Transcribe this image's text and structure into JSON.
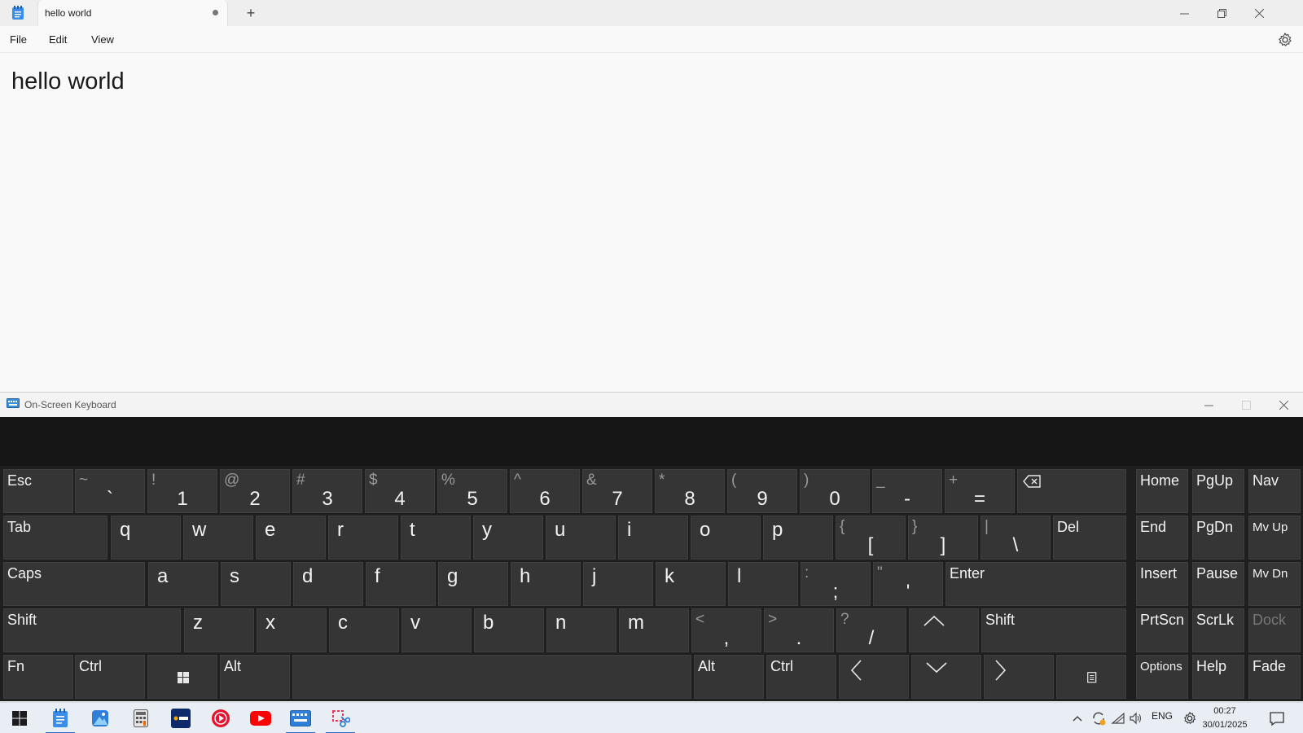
{
  "notepad": {
    "tab_title": "hello world",
    "new_tab_label": "+",
    "menu": {
      "file": "File",
      "edit": "Edit",
      "view": "View"
    },
    "content": "hello world"
  },
  "osk": {
    "title": "On-Screen Keyboard",
    "row1": [
      {
        "type": "single",
        "label": "Esc"
      },
      {
        "type": "dual",
        "top": "~",
        "bottom": "`"
      },
      {
        "type": "dual",
        "top": "!",
        "bottom": "1"
      },
      {
        "type": "dual",
        "top": "@",
        "bottom": "2"
      },
      {
        "type": "dual",
        "top": "#",
        "bottom": "3"
      },
      {
        "type": "dual",
        "top": "$",
        "bottom": "4"
      },
      {
        "type": "dual",
        "top": "%",
        "bottom": "5"
      },
      {
        "type": "dual",
        "top": "^",
        "bottom": "6"
      },
      {
        "type": "dual",
        "top": "&",
        "bottom": "7"
      },
      {
        "type": "dual",
        "top": "*",
        "bottom": "8"
      },
      {
        "type": "dual",
        "top": "(",
        "bottom": "9"
      },
      {
        "type": "dual",
        "top": ")",
        "bottom": "0"
      },
      {
        "type": "dual",
        "top": "_",
        "bottom": "-"
      },
      {
        "type": "dual",
        "top": "+",
        "bottom": "="
      }
    ],
    "row2": [
      {
        "type": "single",
        "label": "Tab"
      },
      {
        "type": "letter",
        "label": "q"
      },
      {
        "type": "letter",
        "label": "w"
      },
      {
        "type": "letter",
        "label": "e"
      },
      {
        "type": "letter",
        "label": "r"
      },
      {
        "type": "letter",
        "label": "t"
      },
      {
        "type": "letter",
        "label": "y"
      },
      {
        "type": "letter",
        "label": "u"
      },
      {
        "type": "letter",
        "label": "i"
      },
      {
        "type": "letter",
        "label": "o"
      },
      {
        "type": "letter",
        "label": "p"
      },
      {
        "type": "dual",
        "top": "{",
        "bottom": "["
      },
      {
        "type": "dual",
        "top": "}",
        "bottom": "]"
      },
      {
        "type": "dual",
        "top": "|",
        "bottom": "\\"
      },
      {
        "type": "single",
        "label": "Del"
      }
    ],
    "row3": [
      {
        "type": "single",
        "label": "Caps"
      },
      {
        "type": "letter",
        "label": "a"
      },
      {
        "type": "letter",
        "label": "s"
      },
      {
        "type": "letter",
        "label": "d"
      },
      {
        "type": "letter",
        "label": "f"
      },
      {
        "type": "letter",
        "label": "g"
      },
      {
        "type": "letter",
        "label": "h"
      },
      {
        "type": "letter",
        "label": "j"
      },
      {
        "type": "letter",
        "label": "k"
      },
      {
        "type": "letter",
        "label": "l"
      },
      {
        "type": "dual",
        "top": ":",
        "bottom": ";"
      },
      {
        "type": "dual",
        "top": "\"",
        "bottom": "'"
      },
      {
        "type": "single",
        "label": "Enter"
      }
    ],
    "row4": [
      {
        "type": "single",
        "label": "Shift"
      },
      {
        "type": "letter",
        "label": "z"
      },
      {
        "type": "letter",
        "label": "x"
      },
      {
        "type": "letter",
        "label": "c"
      },
      {
        "type": "letter",
        "label": "v"
      },
      {
        "type": "letter",
        "label": "b"
      },
      {
        "type": "letter",
        "label": "n"
      },
      {
        "type": "letter",
        "label": "m"
      },
      {
        "type": "dual",
        "top": "<",
        "bottom": ","
      },
      {
        "type": "dual",
        "top": ">",
        "bottom": "."
      },
      {
        "type": "dual",
        "top": "?",
        "bottom": "/"
      },
      {
        "type": "icon",
        "icon": "arrow-up-icon"
      },
      {
        "type": "single",
        "label": "Shift"
      }
    ],
    "row5": [
      {
        "type": "single",
        "label": "Fn"
      },
      {
        "type": "single",
        "label": "Ctrl"
      },
      {
        "type": "icon",
        "icon": "windows-logo-icon"
      },
      {
        "type": "single",
        "label": "Alt"
      },
      {
        "type": "space",
        "label": ""
      },
      {
        "type": "single",
        "label": "Alt"
      },
      {
        "type": "single",
        "label": "Ctrl"
      },
      {
        "type": "icon",
        "icon": "arrow-left-icon"
      },
      {
        "type": "icon",
        "icon": "arrow-down-icon"
      },
      {
        "type": "icon",
        "icon": "arrow-right-icon"
      },
      {
        "type": "icon",
        "icon": "context-menu-icon"
      }
    ],
    "nav_keys": [
      [
        "Home",
        "PgUp",
        "Nav"
      ],
      [
        "End",
        "PgDn",
        "Mv Up"
      ],
      [
        "Insert",
        "Pause",
        "Mv Dn"
      ],
      [
        "PrtScn",
        "ScrLk",
        "Dock"
      ],
      [
        "Options",
        "Help",
        "Fade"
      ]
    ],
    "disabled_keys": [
      "Dock"
    ],
    "small_keys": [
      "Options",
      "Mv Up",
      "Mv Dn"
    ]
  },
  "taskbar": {
    "apps": [
      "start-icon",
      "notepad-icon",
      "photos-icon",
      "calculator-icon",
      "uol-icon",
      "media-player-icon",
      "youtube-icon",
      "on-screen-keyboard-icon",
      "snipping-tool-icon"
    ],
    "active_apps": [
      "notepad-icon",
      "on-screen-keyboard-icon",
      "snipping-tool-icon"
    ],
    "language": "ENG",
    "time": "00:27",
    "date": "30/01/2025"
  },
  "colors": {
    "accent": "#2b6fd6",
    "key_bg": "#353535",
    "osk_bg": "#1f1f1f"
  }
}
